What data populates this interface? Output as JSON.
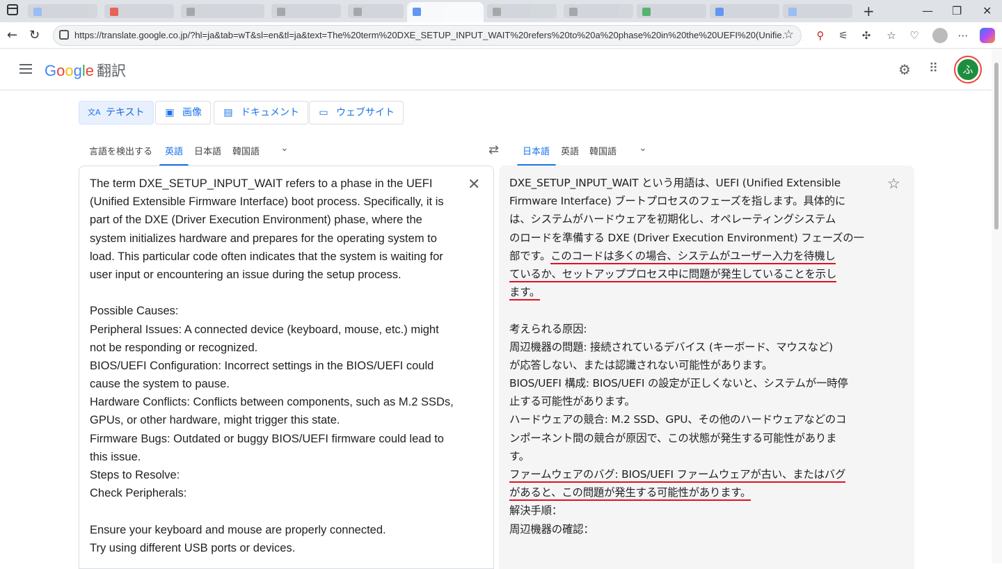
{
  "browser": {
    "url": "https://translate.google.co.jp/?hl=ja&tab=wT&sl=en&tl=ja&text=The%20term%20DXE_SETUP_INPUT_WAIT%20refers%20to%20a%20phase%20in%20the%20UEFI%20(Unifie…",
    "new_tab_label": "+",
    "minimize_label": "—",
    "restore_label": "❐",
    "close_label": "✕"
  },
  "header": {
    "logo_letters": [
      "G",
      "o",
      "o",
      "g",
      "l",
      "e"
    ],
    "product": "翻訳",
    "avatar_initial": "ふ"
  },
  "modes": [
    {
      "label": "テキスト",
      "icon": "文A"
    },
    {
      "label": "画像",
      "icon": "▣"
    },
    {
      "label": "ドキュメント",
      "icon": "▤"
    },
    {
      "label": "ウェブサイト",
      "icon": "▭"
    }
  ],
  "source_langs": [
    "言語を検出する",
    "英語",
    "日本語",
    "韓国語"
  ],
  "target_langs": [
    "日本語",
    "英語",
    "韓国語"
  ],
  "source_lines": [
    "The term DXE_SETUP_INPUT_WAIT refers to a phase in the UEFI",
    "(Unified Extensible Firmware Interface) boot process. Specifically, it is",
    "part of the DXE (Driver Execution Environment) phase, where the",
    "system initializes hardware and prepares for the operating system to",
    "load. This particular code often indicates that the system is waiting for",
    "user input or encountering an issue during the setup process.",
    "",
    "Possible Causes:",
    "Peripheral Issues: A connected device (keyboard, mouse, etc.) might",
    "not be responding or recognized.",
    "BIOS/UEFI Configuration: Incorrect settings in the BIOS/UEFI could",
    "cause the system to pause.",
    "Hardware Conflicts: Conflicts between components, such as M.2 SSDs,",
    "GPUs, or other hardware, might trigger this state.",
    "Firmware Bugs: Outdated or buggy BIOS/UEFI firmware could lead to",
    "this issue.",
    "Steps to Resolve:",
    "Check Peripherals:",
    "",
    "Ensure your keyboard and mouse are properly connected.",
    "Try using different USB ports or devices."
  ],
  "target": {
    "l1": "DXE_SETUP_INPUT_WAIT という用語は、UEFI (Unified Extensible",
    "l2": "Firmware Interface) ブートプロセスのフェーズを指します。具体的に",
    "l3": "は、システムがハードウェアを初期化し、オペレーティングシステム",
    "l4": "のロードを準備する DXE (Driver Execution Environment) フェーズの一",
    "l5a": "部です。",
    "l5b": "このコードは多くの場合、システムがユーザー入力を待機し",
    "l6": "ているか、セットアッププロセス中に問題が発生していることを示し",
    "l7": "ます。",
    "l9": "考えられる原因:",
    "l10": "周辺機器の問題: 接続されているデバイス (キーボード、マウスなど)",
    "l11": "が応答しない、または認識されない可能性があります。",
    "l12": "BIOS/UEFI 構成: BIOS/UEFI の設定が正しくないと、システムが一時停",
    "l13": "止する可能性があります。",
    "l14": "ハードウェアの競合: M.2 SSD、GPU、その他のハードウェアなどのコ",
    "l15": "ンポーネント間の競合が原因で、この状態が発生する可能性がありま",
    "l16": "す。",
    "l17": "ファームウェアのバグ: BIOS/UEFI ファームウェアが古い、またはバグ",
    "l18": "があると、この問題が発生する可能性があります。",
    "l19": "解決手順：",
    "l20": "周辺機器の確認："
  },
  "colors": {
    "accent": "#1a73e8",
    "underline": "#e3101d",
    "target_bg": "#f5f5f5"
  }
}
